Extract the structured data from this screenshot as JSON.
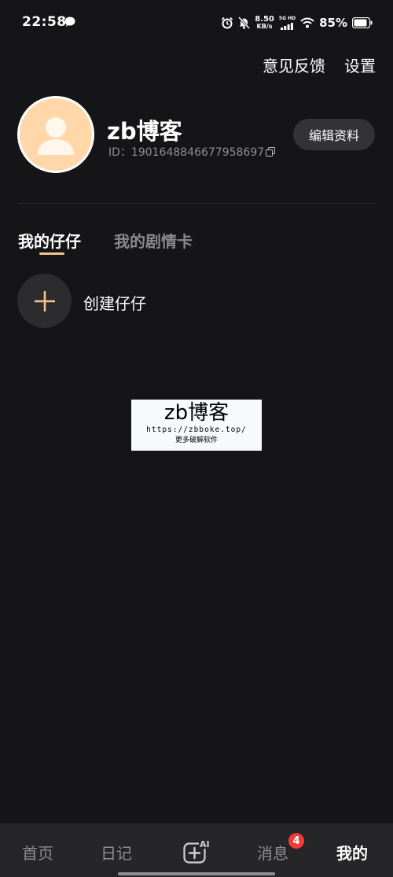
{
  "status_bar": {
    "time": "22:58",
    "net_speed_value": "8.50",
    "net_speed_unit": "KB/s",
    "network_type": "5G HD",
    "battery": "85%"
  },
  "top_actions": {
    "feedback": "意见反馈",
    "settings": "设置"
  },
  "profile": {
    "username": "zb博客",
    "id_text": "ID：1901648846677958697",
    "edit_label": "编辑资料"
  },
  "tabs": [
    {
      "label": "我的仔仔",
      "active": true
    },
    {
      "label": "我的剧情卡",
      "active": false
    }
  ],
  "create": {
    "label": "创建仔仔"
  },
  "watermark": {
    "title": "zb博客",
    "url": "https://zbboke.top/",
    "subtitle": "更多破解软件"
  },
  "bottom_nav": {
    "home": "首页",
    "diary": "日记",
    "messages": "消息",
    "messages_badge": "4",
    "mine": "我的"
  },
  "colors": {
    "background": "#151517",
    "accent": "#f3c58b",
    "avatar_bg": "#ffd7a8",
    "badge": "#f23a3a",
    "nav_bg": "#262628"
  },
  "icons": {
    "status_chat": "chat-bubble-icon",
    "alarm": "alarm-icon",
    "mute": "bell-off-icon",
    "signal": "signal-icon",
    "wifi": "wifi-icon",
    "battery": "battery-icon",
    "copy": "copy-icon",
    "plus": "plus-icon",
    "ai_create": "ai-plus-icon"
  }
}
